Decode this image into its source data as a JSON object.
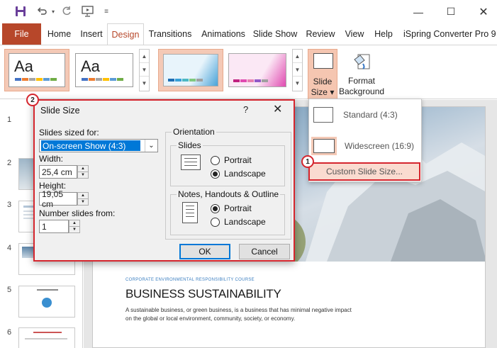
{
  "ribbon_tabs": [
    "File",
    "Home",
    "Insert",
    "Design",
    "Transitions",
    "Animations",
    "Slide Show",
    "Review",
    "View",
    "Help",
    "iSpring Converter Pro 9"
  ],
  "ribbon": {
    "theme_aa": "Aa",
    "slide_size_label_1": "Slide",
    "slide_size_label_2": "Size",
    "format_bg_label_1": "Format",
    "format_bg_label_2": "Background"
  },
  "slide_size_menu": {
    "standard": "Standard (4:3)",
    "widescreen": "Widescreen (16:9)",
    "custom": "Custom Slide Size..."
  },
  "dialog": {
    "title": "Slide Size",
    "help": "?",
    "sized_for_label": "Slides sized for:",
    "sized_for_value": "On-screen Show (4:3)",
    "width_label": "Width:",
    "width_value": "25,4 cm",
    "height_label": "Height:",
    "height_value": "19,05 cm",
    "number_from_label": "Number slides from:",
    "number_from_value": "1",
    "orientation_title": "Orientation",
    "slides_group": "Slides",
    "portrait": "Portrait",
    "landscape": "Landscape",
    "notes_group": "Notes, Handouts & Outline",
    "notes_portrait": "Portrait",
    "notes_landscape": "Landscape",
    "ok": "OK",
    "cancel": "Cancel"
  },
  "callouts": {
    "one": "1",
    "two": "2"
  },
  "thumbnails": [
    "1",
    "2",
    "3",
    "4",
    "5",
    "6"
  ],
  "slide": {
    "kicker": "CORPORATE ENVIRONMENTAL RESPONSIBILITY COURSE",
    "title": "BUSINESS SUSTAINABILITY",
    "body": "A sustainable business, or green business, is a business that has minimal negative impact on the global or local environment, community, society, or economy."
  },
  "colors": {
    "accent": "#b7472a",
    "callout": "#d5262e",
    "selection": "#0078d7"
  }
}
